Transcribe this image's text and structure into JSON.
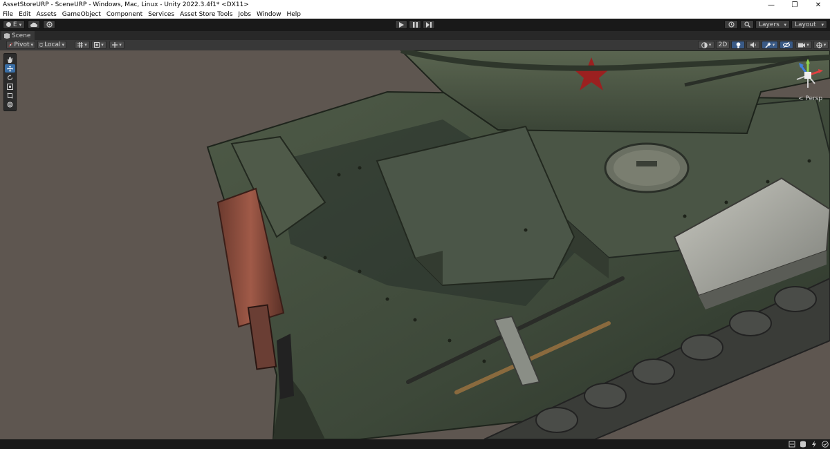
{
  "window": {
    "title": "AssetStoreURP - SceneURP - Windows, Mac, Linux - Unity 2022.3.4f1* <DX11>",
    "minimize_glyph": "—",
    "restore_glyph": "❐",
    "close_glyph": "✕"
  },
  "menu": {
    "items": [
      "File",
      "Edit",
      "Assets",
      "GameObject",
      "Component",
      "Services",
      "Asset Store Tools",
      "Jobs",
      "Window",
      "Help"
    ]
  },
  "toolbar": {
    "account_label": "E",
    "layers_label": "Layers",
    "layout_label": "Layout"
  },
  "scene_tab": {
    "label": "Scene"
  },
  "scene_toolbar": {
    "pivot_label": "Pivot",
    "local_label": "Local",
    "mode_2d_label": "2D"
  },
  "viewport": {
    "projection_label": "< Persp",
    "background_color": "#5e5650",
    "hull_color": "#3f4a3a",
    "star_color": "#9b2020",
    "rust_color": "#8a4a3a"
  },
  "icons": {
    "tools": [
      "hand-tool-icon",
      "move-tool-icon",
      "rotate-tool-icon",
      "scale-tool-icon",
      "rect-tool-icon",
      "transform-tool-icon"
    ]
  }
}
